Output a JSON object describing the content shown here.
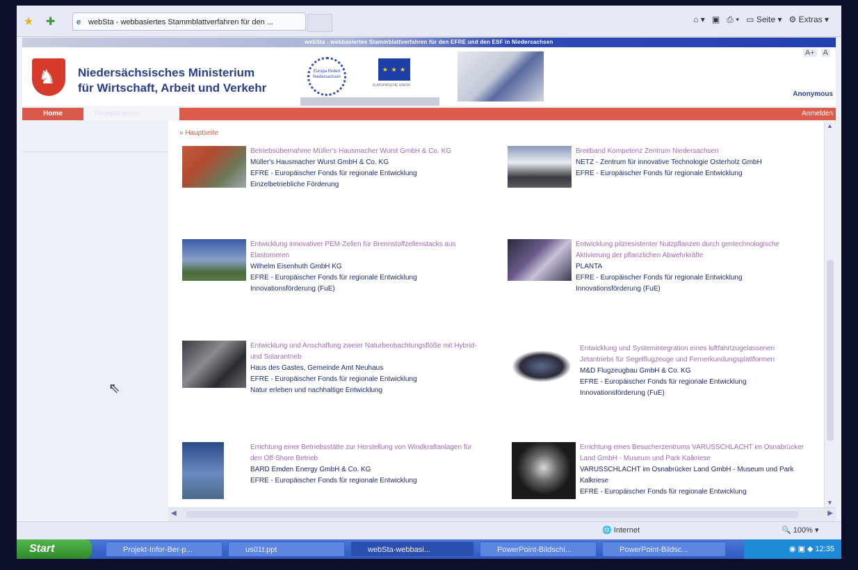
{
  "browser": {
    "tab_title": "webSta - webbasiertes Stammblattverfahren für den ...",
    "tools": [
      "Seite",
      "Extras"
    ]
  },
  "site": {
    "top_strip": "webSta - webbasiertes Stammblattverfahren für den EFRE und den ESF in Niedersachsen",
    "font_controls": [
      "A+",
      "A"
    ],
    "ministry_line1": "Niedersächsisches Ministerium",
    "ministry_line2": "für Wirtschaft, Arbeit und Verkehr",
    "eu_label": "Europa fördert Niedersachsen",
    "eu_caption": "EUROPÄISCHE UNION",
    "user": "Anonymous",
    "nav_home": "Home",
    "nav_projects": "Projektthemen",
    "nav_login": "Anmelden",
    "breadcrumb": "» Hauptseite"
  },
  "projects": [
    {
      "title": "Betriebsübernahme Müller's Hausmacher Wurst GmbH & Co. KG",
      "lines": [
        "Müller's Hausmacher Wurst GmbH & Co. KG",
        "EFRE - Europäischer Fonds für regionale Entwicklung",
        "Einzelbetriebliche Förderung"
      ]
    },
    {
      "title": "Breitband Kompetenz Zentrum Niedersachsen",
      "lines": [
        "NETZ - Zentrum für innovative Technologie Osterholz GmbH",
        "EFRE - Europäischer Fonds für regionale Entwicklung"
      ]
    },
    {
      "title": "Entwicklung innovativer PEM-Zellen für Brennstoffzellenstacks aus Elastomeren",
      "lines": [
        "Wilhelm Eisenhuth GmbH KG",
        "EFRE - Europäischer Fonds für regionale Entwicklung",
        "Innovationsförderung (FuE)"
      ]
    },
    {
      "title": "Entwicklung pilzresistenter Nutzpflanzen durch gentechnologische Aktivierung der pflanzlichen Abwehrkräfte",
      "lines": [
        "PLANTA",
        "EFRE - Europäischer Fonds für regionale Entwicklung",
        "Innovationsförderung (FuE)"
      ]
    },
    {
      "title": "Entwicklung und Anschaffung zweier Naturbeobachtungsflöße mit Hybrid- und Solarantrieb",
      "lines": [
        "Haus des Gastes, Gemeinde Amt Neuhaus",
        "EFRE - Europäischer Fonds für regionale Entwicklung",
        "Natur erleben und nachhaltige Entwicklung"
      ]
    },
    {
      "title": "Entwicklung und Systemintegration eines luftfahrtzugelassenen Jetantriebs für Segelflugzeuge und Fernerkundungsplattformen",
      "lines": [
        "M&D Flugzeugbau GmbH & Co. KG",
        "EFRE - Europäischer Fonds für regionale Entwicklung",
        "Innovationsförderung (FuE)"
      ]
    },
    {
      "title": "Errichtung einer Betriebsstätte zur Herstellung von Windkraftanlagen für den Off-Shore Betrieb",
      "lines": [
        "BARD Emden Energy GmbH & Co. KG",
        "EFRE - Europäischer Fonds für regionale Entwicklung"
      ]
    },
    {
      "title": "Errichtung eines Besucherzentrums VARUSSCHLACHT im Osnabrücker Land GmbH - Museum und Park Kalkriese",
      "lines": [
        "VARUSSCHLACHT im Osnabrücker Land GmbH - Museum und Park Kalkriese",
        "EFRE - Europäischer Fonds für regionale Entwicklung"
      ]
    }
  ],
  "status": {
    "zone": "Internet",
    "zoom": "100%"
  },
  "taskbar": {
    "start": "Start",
    "tasks": [
      "Projekt-Infor-Ber-p...",
      "us01t.ppt",
      "webSta-webbasi...",
      "PowerPoint-Bildschi...",
      "PowerPoint-Bildsc..."
    ],
    "clock": "12:35"
  }
}
